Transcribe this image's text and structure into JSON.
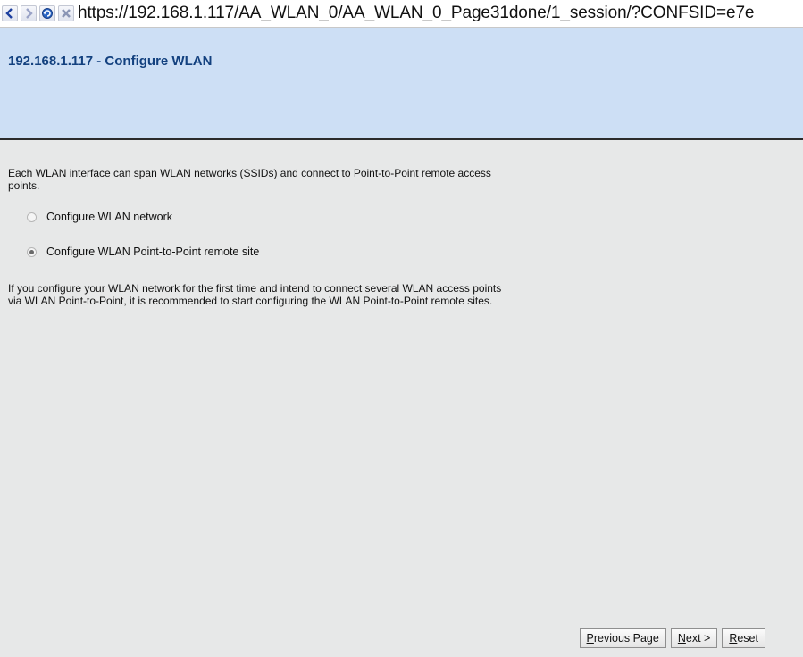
{
  "browser": {
    "url": "https://192.168.1.117/AA_WLAN_0/AA_WLAN_0_Page31done/1_session/?CONFSID=e7e",
    "icons": [
      "back-arrow-icon",
      "forward-arrow-icon",
      "refresh-icon",
      "stop-icon"
    ]
  },
  "header": {
    "title": "192.168.1.117 - Configure WLAN"
  },
  "main": {
    "intro": "Each WLAN interface can span WLAN networks (SSIDs) and connect to Point-to-Point remote access points.",
    "options": [
      {
        "label": "Configure WLAN network",
        "selected": false
      },
      {
        "label": "Configure WLAN Point-to-Point remote site",
        "selected": true
      }
    ],
    "note": "If you configure your WLAN network for the first time and intend to connect several WLAN access points via WLAN Point-to-Point, it is recommended to start configuring the WLAN Point-to-Point remote sites."
  },
  "footer": {
    "previous": {
      "accel": "P",
      "rest": "revious Page"
    },
    "next": {
      "accel": "N",
      "rest": "ext >"
    },
    "reset": {
      "accel": "R",
      "rest": "eset"
    }
  },
  "colors": {
    "header_bg": "#cddff5",
    "title": "#13417f",
    "page_bg": "#e7e8e8"
  }
}
